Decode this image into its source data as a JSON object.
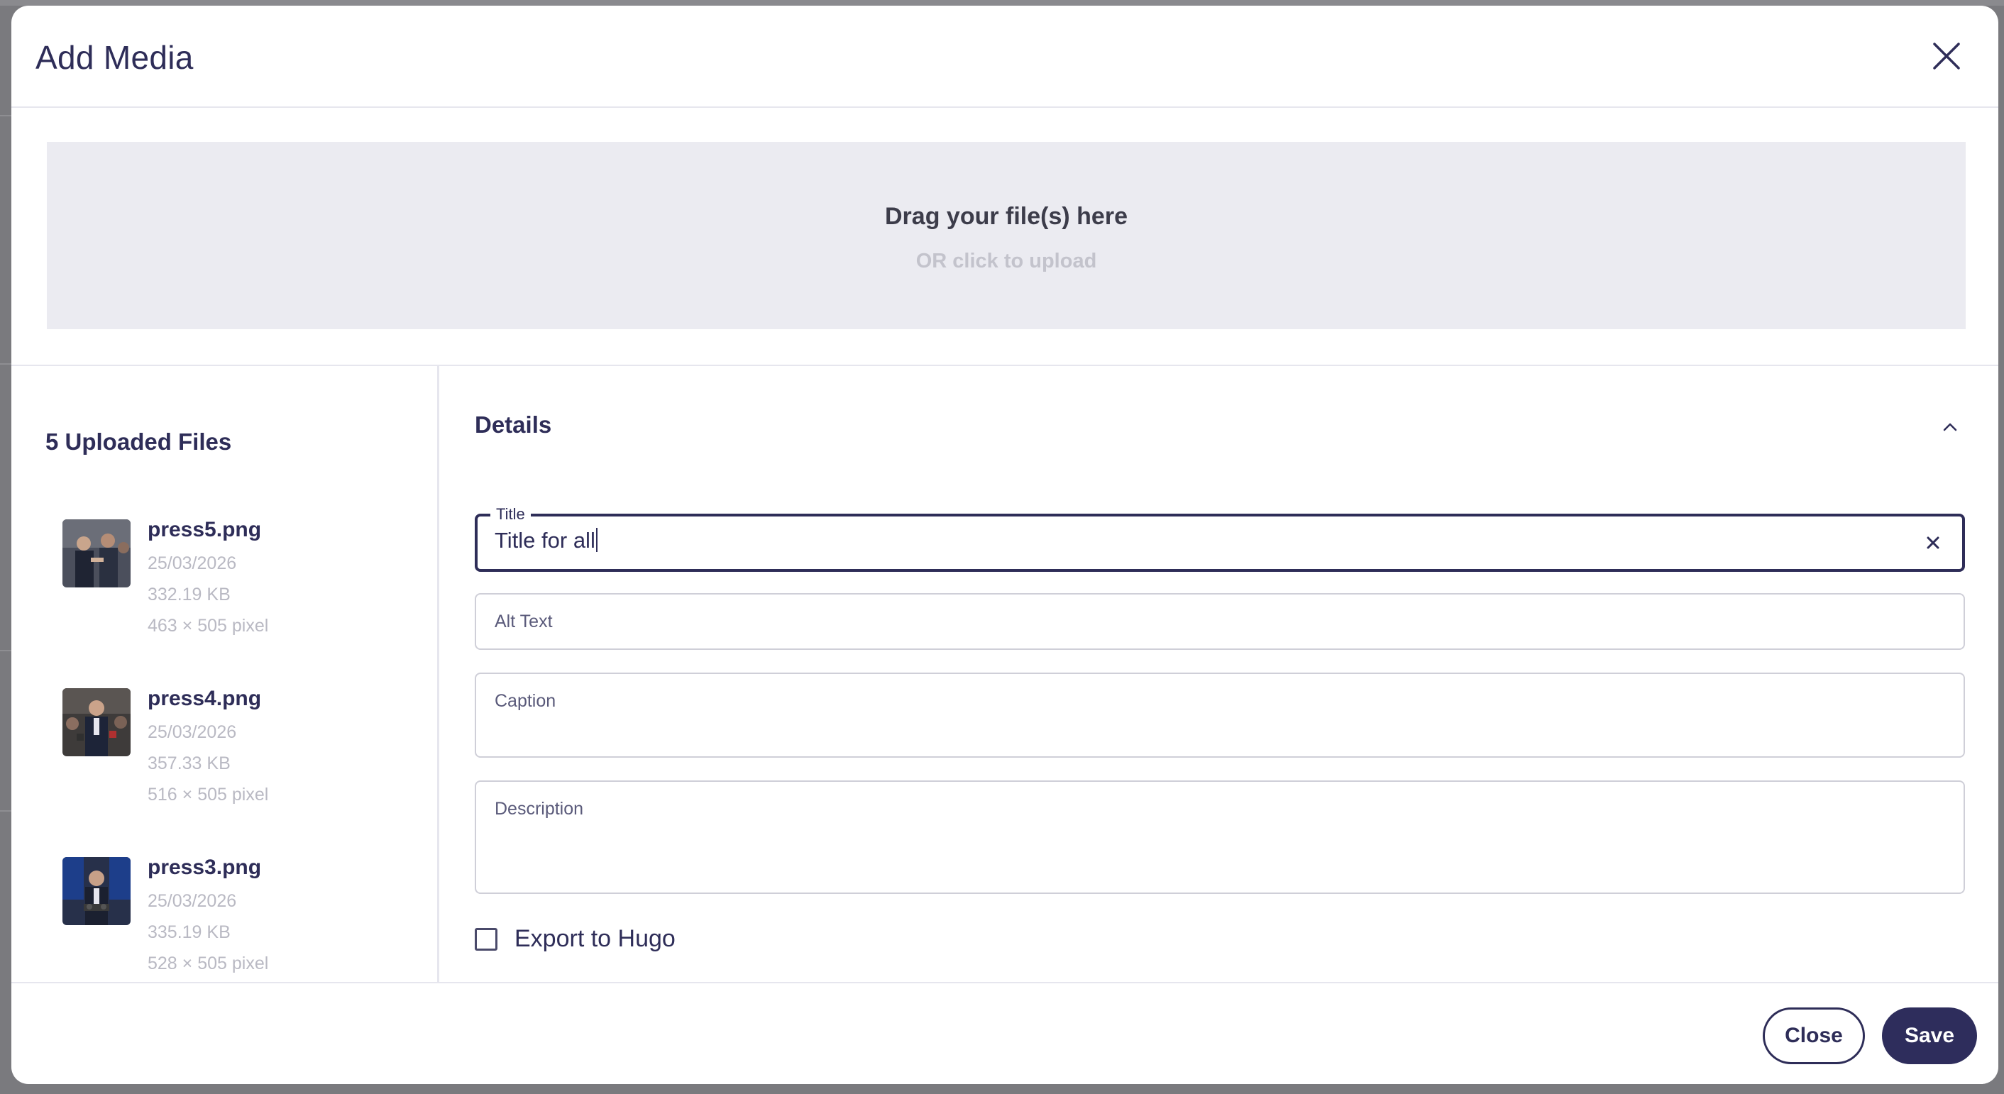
{
  "modal": {
    "title": "Add Media"
  },
  "dropzone": {
    "title": "Drag your file(s) here",
    "subtitle": "OR click to upload"
  },
  "files": {
    "heading": "5 Uploaded Files",
    "items": [
      {
        "name": "press5.png",
        "date": "25/03/2026",
        "size": "332.19 KB",
        "dimensions": "463 × 505 pixel"
      },
      {
        "name": "press4.png",
        "date": "25/03/2026",
        "size": "357.33 KB",
        "dimensions": "516 × 505 pixel"
      },
      {
        "name": "press3.png",
        "date": "25/03/2026",
        "size": "335.19 KB",
        "dimensions": "528 × 505 pixel"
      }
    ]
  },
  "details": {
    "heading": "Details",
    "title_label": "Title",
    "title_value": "Title for all",
    "alt_text_label": "Alt Text",
    "caption_label": "Caption",
    "description_label": "Description",
    "export_label": "Export to Hugo",
    "export_checked": false
  },
  "footer": {
    "close_label": "Close",
    "save_label": "Save"
  },
  "colors": {
    "primary": "#2e2d58",
    "dropzone_bg": "#ebebf1",
    "muted_text": "#b9b9c3",
    "border": "#cfcfd8"
  }
}
